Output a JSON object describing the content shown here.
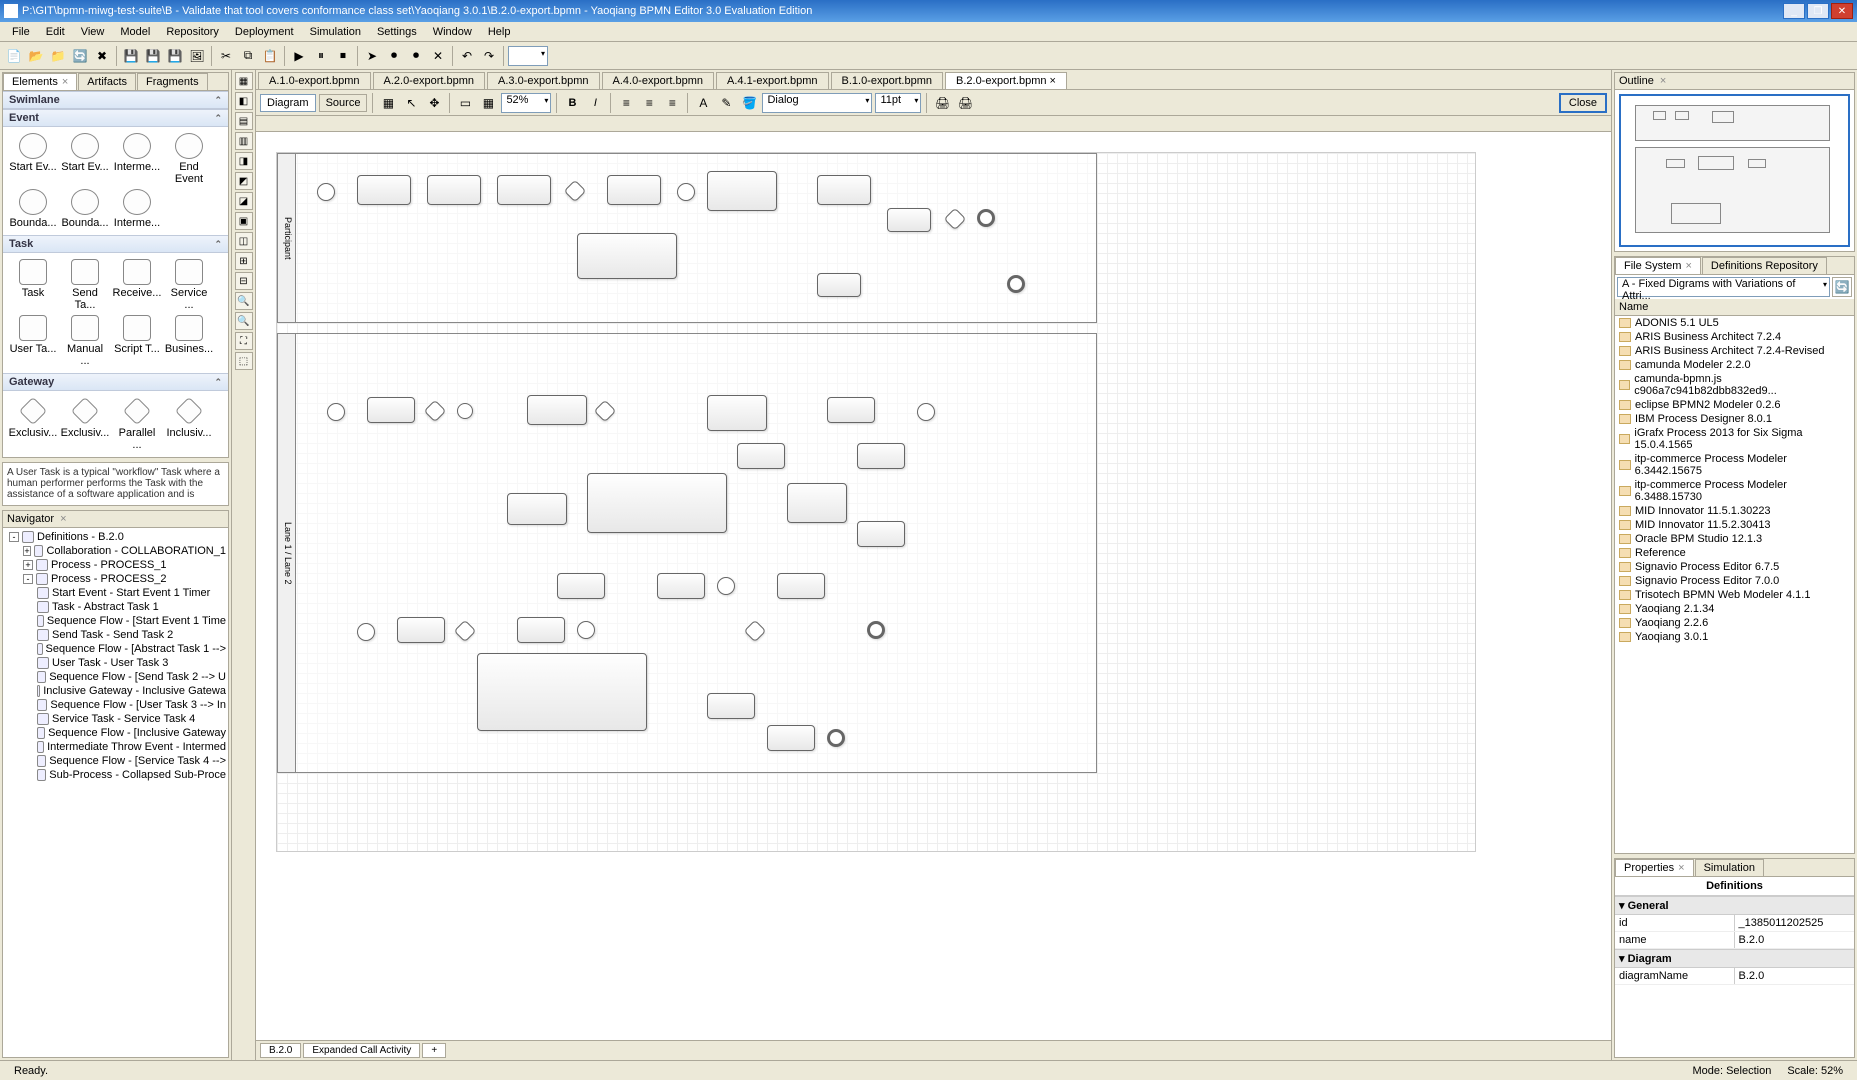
{
  "window": {
    "title": "P:\\GIT\\bpmn-miwg-test-suite\\B - Validate that tool covers conformance class set\\Yaoqiang 3.0.1\\B.2.0-export.bpmn - Yaoqiang BPMN Editor 3.0 Evaluation Edition"
  },
  "menu": [
    "File",
    "Edit",
    "View",
    "Model",
    "Repository",
    "Deployment",
    "Simulation",
    "Settings",
    "Window",
    "Help"
  ],
  "palette": {
    "tabs": [
      "Elements",
      "Artifacts",
      "Fragments"
    ],
    "groups": [
      {
        "name": "Swimlane",
        "items": []
      },
      {
        "name": "Event",
        "items": [
          "Start Ev...",
          "Start Ev...",
          "Interme...",
          "End Event",
          "Bounda...",
          "Bounda...",
          "Interme..."
        ]
      },
      {
        "name": "Task",
        "items": [
          "Task",
          "Send Ta...",
          "Receive...",
          "Service ...",
          "User Ta...",
          "Manual ...",
          "Script T...",
          "Busines..."
        ]
      },
      {
        "name": "Gateway",
        "items": [
          "Exclusiv...",
          "Exclusiv...",
          "Parallel ...",
          "Inclusiv..."
        ]
      }
    ],
    "help": "A User Task is a typical \"workflow\" Task where a human performer performs the Task with the assistance of a software application and is"
  },
  "navigator": {
    "title": "Navigator",
    "root": "Definitions - B.2.0",
    "nodes": [
      {
        "indent": 0,
        "toggle": "-",
        "label": "Definitions - B.2.0"
      },
      {
        "indent": 1,
        "toggle": "+",
        "label": "Collaboration - COLLABORATION_1"
      },
      {
        "indent": 1,
        "toggle": "+",
        "label": "Process - PROCESS_1"
      },
      {
        "indent": 1,
        "toggle": "-",
        "label": "Process - PROCESS_2"
      },
      {
        "indent": 2,
        "toggle": "",
        "label": "Start Event - Start Event 1 Timer"
      },
      {
        "indent": 2,
        "toggle": "",
        "label": "Task - Abstract Task 1"
      },
      {
        "indent": 2,
        "toggle": "",
        "label": "Sequence Flow - [Start Event 1 Time"
      },
      {
        "indent": 2,
        "toggle": "",
        "label": "Send Task - Send Task 2"
      },
      {
        "indent": 2,
        "toggle": "",
        "label": "Sequence Flow - [Abstract Task 1 -->"
      },
      {
        "indent": 2,
        "toggle": "",
        "label": "User Task - User Task 3"
      },
      {
        "indent": 2,
        "toggle": "",
        "label": "Sequence Flow - [Send Task 2 --> U"
      },
      {
        "indent": 2,
        "toggle": "",
        "label": "Inclusive Gateway - Inclusive Gatewa"
      },
      {
        "indent": 2,
        "toggle": "",
        "label": "Sequence Flow - [User Task 3 --> In"
      },
      {
        "indent": 2,
        "toggle": "",
        "label": "Service Task - Service Task 4"
      },
      {
        "indent": 2,
        "toggle": "",
        "label": "Sequence Flow - [Inclusive Gateway"
      },
      {
        "indent": 2,
        "toggle": "",
        "label": "Intermediate Throw Event - Intermed"
      },
      {
        "indent": 2,
        "toggle": "",
        "label": "Sequence Flow - [Service Task 4 -->"
      },
      {
        "indent": 2,
        "toggle": "",
        "label": "Sub-Process - Collapsed Sub-Proce"
      }
    ]
  },
  "fileTabs": [
    "A.1.0-export.bpmn",
    "A.2.0-export.bpmn",
    "A.3.0-export.bpmn",
    "A.4.0-export.bpmn",
    "A.4.1-export.bpmn",
    "B.1.0-export.bpmn",
    "B.2.0-export.bpmn"
  ],
  "activeFileTab": 6,
  "editorToolbar": {
    "viewModes": [
      "Diagram",
      "Source"
    ],
    "zoom": "52%",
    "font": "Dialog",
    "fontSize": "11pt",
    "close": "Close"
  },
  "bottomTabs": [
    "B.2.0",
    "Expanded Call Activity"
  ],
  "outline": {
    "title": "Outline"
  },
  "fileSystem": {
    "tabs": [
      "File System",
      "Definitions Repository"
    ],
    "path": "A - Fixed Digrams with Variations of Attri...",
    "colHeader": "Name",
    "rows": [
      "ADONIS 5.1 UL5",
      "ARIS Business Architect 7.2.4",
      "ARIS Business Architect 7.2.4-Revised",
      "camunda Modeler 2.2.0",
      "camunda-bpmn.js c906a7c941b82dbb832ed9...",
      "eclipse BPMN2 Modeler 0.2.6",
      "IBM Process Designer 8.0.1",
      "iGrafx Process 2013 for Six Sigma 15.0.4.1565",
      "itp-commerce Process Modeler 6.3442.15675",
      "itp-commerce Process Modeler 6.3488.15730",
      "MID Innovator 11.5.1.30223",
      "MID Innovator 11.5.2.30413",
      "Oracle BPM Studio 12.1.3",
      "Reference",
      "Signavio Process Editor 6.7.5",
      "Signavio Process Editor 7.0.0",
      "Trisotech BPMN Web Modeler 4.1.1",
      "Yaoqiang 2.1.34",
      "Yaoqiang 2.2.6",
      "Yaoqiang 3.0.1"
    ]
  },
  "properties": {
    "tabs": [
      "Properties",
      "Simulation"
    ],
    "header": "Definitions",
    "groups": [
      {
        "name": "General",
        "rows": [
          [
            "id",
            "_1385011202525"
          ],
          [
            "name",
            "B.2.0"
          ]
        ]
      },
      {
        "name": "Diagram",
        "rows": [
          [
            "diagramName",
            "B.2.0"
          ]
        ]
      }
    ]
  },
  "status": {
    "ready": "Ready.",
    "mode": "Mode: Selection",
    "scale": "Scale: 52%"
  }
}
